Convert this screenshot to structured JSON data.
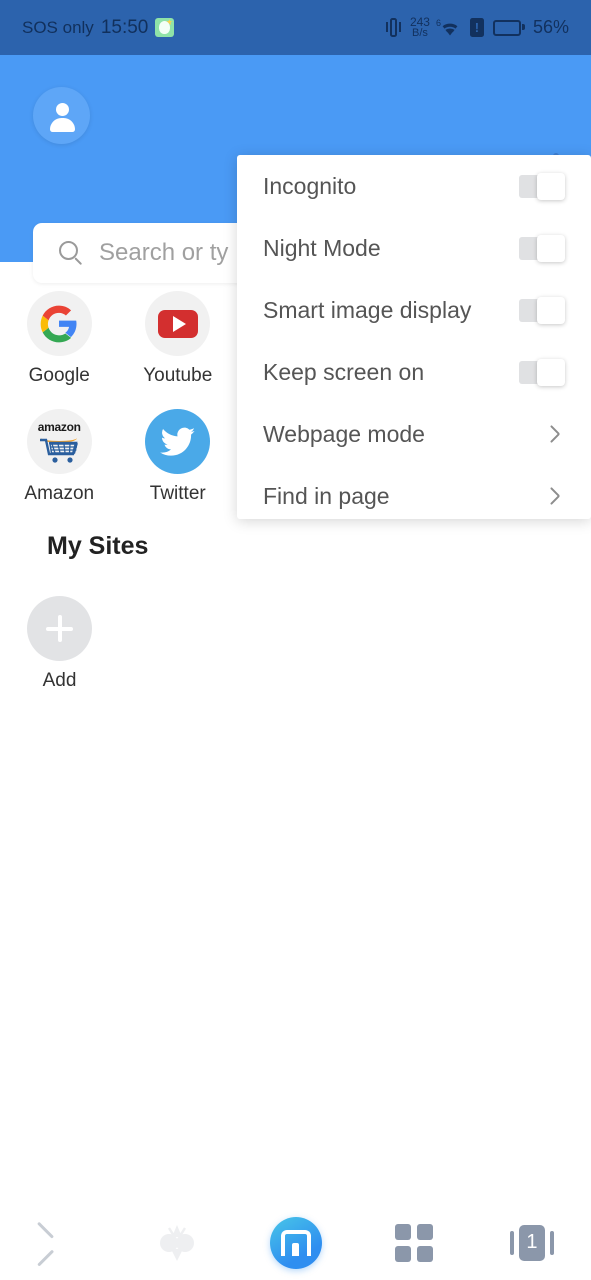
{
  "statusbar": {
    "carrier": "SOS only",
    "time": "15:50",
    "app_icon": "sheep-app-icon",
    "vibrate_icon": "vibrate-icon",
    "network_speed_value": "243",
    "network_speed_unit": "B/s",
    "wifi_icon": "wifi-icon",
    "wifi_generation": "6",
    "sim_alert_icon": "sim-alert-icon",
    "battery_icon": "battery-icon",
    "battery_percent": "56%",
    "battery_level": 56,
    "background_color": "#2c63ad",
    "text_color": "#12315e"
  },
  "header": {
    "background_color": "#4a9af5",
    "avatar_icon": "user-avatar-icon",
    "overflow_menu_icon": "three-dots-vertical-icon",
    "search": {
      "icon": "search-icon",
      "placeholder": "Search or ty",
      "value": ""
    }
  },
  "shortcuts": {
    "items": [
      {
        "label": "Google",
        "icon": "google-icon"
      },
      {
        "label": "Youtube",
        "icon": "youtube-icon"
      },
      {
        "label": "Amazon",
        "icon": "amazon-icon"
      },
      {
        "label": "Twitter",
        "icon": "twitter-icon"
      }
    ]
  },
  "my_sites": {
    "title": "My Sites",
    "add": {
      "label": "Add",
      "icon": "plus-icon"
    }
  },
  "dropdown_menu": {
    "items": [
      {
        "label": "Incognito",
        "type": "toggle",
        "state": "off",
        "icon": "toggle-switch"
      },
      {
        "label": "Night Mode",
        "type": "toggle",
        "state": "off",
        "icon": "toggle-switch"
      },
      {
        "label": "Smart image display",
        "type": "toggle",
        "state": "off",
        "icon": "toggle-switch"
      },
      {
        "label": "Keep screen on",
        "type": "toggle",
        "state": "off",
        "icon": "toggle-switch"
      },
      {
        "label": "Webpage mode",
        "type": "submenu",
        "icon": "chevron-right-icon"
      },
      {
        "label": "Find in page",
        "type": "submenu",
        "icon": "chevron-right-icon"
      }
    ]
  },
  "bottom_nav": {
    "items": [
      {
        "name": "back",
        "icon": "chevron-left-icon"
      },
      {
        "name": "mx-flower",
        "icon": "flower-icon"
      },
      {
        "name": "home",
        "icon": "maxthon-logo-icon"
      },
      {
        "name": "apps",
        "icon": "grid-icon"
      },
      {
        "name": "tabs",
        "icon": "tab-counter-icon",
        "count": "1"
      }
    ]
  },
  "colors": {
    "header_blue": "#4a9af5",
    "status_blue": "#2c63ad",
    "accent": "#2f8ef0",
    "menu_text": "#555555",
    "toggle_off_track": "#e0e1e3"
  }
}
